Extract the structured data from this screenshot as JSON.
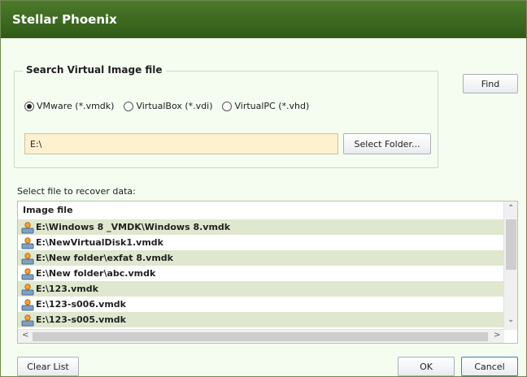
{
  "window": {
    "title": "Stellar Phoenix"
  },
  "search_group": {
    "legend": "Search Virtual Image file",
    "radios": [
      {
        "label": "VMware (*.vmdk)",
        "checked": true
      },
      {
        "label": "VirtualBox (*.vdi)",
        "checked": false
      },
      {
        "label": "VirtualPC (*.vhd)",
        "checked": false
      }
    ],
    "path_value": "E:\\",
    "select_folder_label": "Select Folder..."
  },
  "find_label": "Find",
  "list": {
    "caption": "Select file to recover data:",
    "column_header": "Image file",
    "rows": [
      "E:\\Windows 8 _VMDK\\Windows 8.vmdk",
      "E:\\NewVirtualDisk1.vmdk",
      "E:\\New folder\\exfat 8.vmdk",
      "E:\\New folder\\abc.vmdk",
      "E:\\123.vmdk",
      "E:\\123-s006.vmdk",
      "E:\\123-s005.vmdk"
    ],
    "row_icon": "disk-user-icon"
  },
  "buttons": {
    "clear_list": "Clear List",
    "ok": "OK",
    "cancel": "Cancel"
  },
  "colors": {
    "title_bar": "#3c6a22",
    "window_bg": "#f5fcf0",
    "row_alt": "#dfe8cf",
    "path_bg": "#fdf1cf"
  }
}
